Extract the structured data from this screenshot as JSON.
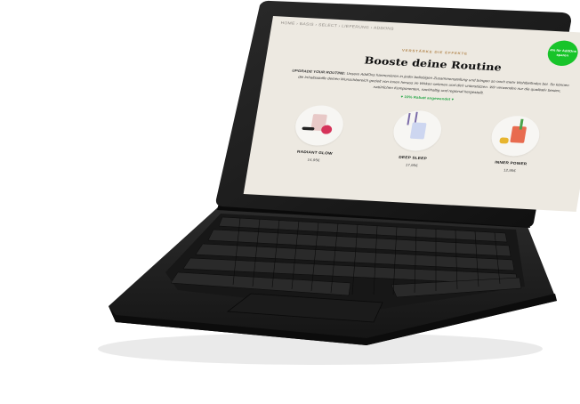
{
  "screen": {
    "breadcrumb": "HOME › BASIS › SELECT › LIEFERUNG › ADDONS",
    "kicker": "VERSTÄRKE DIE EFFEKTE",
    "title": "Booste deine Routine",
    "intro_bold": "UPGRADE YOUR ROUTINE:",
    "intro_text": "Unsere AddOns harmonieren in jeder beliebigen Zusammenstellung und bringen so noch mehr Wohlbefinden bei. So können die Inhaltsstoffe deinen Wunschbereich gezielt von innen heraus im Wirken nehmen und dich unterstützen. Wir verwenden nur die qualitativ besten, natürlichen Komponenten, nachhaltig und regional hergestellt.",
    "discount_note": "♥ 10% Rabatt angewendet ♥",
    "badge": "4% für AddOns sparen",
    "products": [
      {
        "name": "RADIANT GLOW",
        "price": "14,95€"
      },
      {
        "name": "DEEP SLEEP",
        "price": "17,95€"
      },
      {
        "name": "INNER POWER",
        "price": "12,95€"
      }
    ]
  },
  "colors": {
    "screen_bg": "#ede9e1",
    "badge": "#18c42a",
    "kicker": "#b3874f",
    "laptop_body": "#1e1e1e"
  }
}
